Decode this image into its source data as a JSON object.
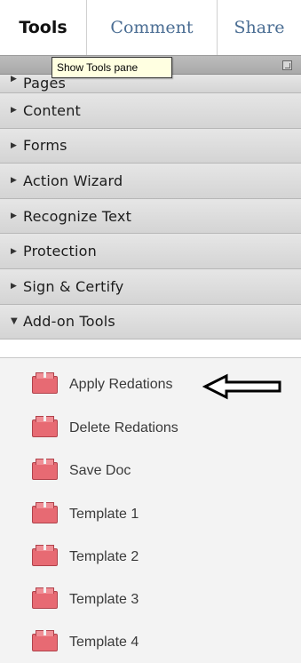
{
  "tabs": {
    "tools": "Tools",
    "comment": "Comment",
    "share": "Share"
  },
  "tooltip": "Show Tools pane",
  "panels": [
    {
      "label": "Pages",
      "state": "collapsed"
    },
    {
      "label": "Content",
      "state": "collapsed"
    },
    {
      "label": "Forms",
      "state": "collapsed"
    },
    {
      "label": "Action Wizard",
      "state": "collapsed"
    },
    {
      "label": "Recognize Text",
      "state": "collapsed"
    },
    {
      "label": "Protection",
      "state": "collapsed"
    },
    {
      "label": "Sign & Certify",
      "state": "collapsed"
    },
    {
      "label": "Add-on Tools",
      "state": "expanded"
    }
  ],
  "addon_tools": [
    {
      "label": "Apply Redations",
      "icon": "toolbox-icon"
    },
    {
      "label": "Delete Redations",
      "icon": "toolbox-icon"
    },
    {
      "label": "Save Doc",
      "icon": "toolbox-icon"
    },
    {
      "label": "Template 1",
      "icon": "toolbox-icon"
    },
    {
      "label": "Template 2",
      "icon": "toolbox-icon"
    },
    {
      "label": "Template 3",
      "icon": "toolbox-icon"
    },
    {
      "label": "Template 4",
      "icon": "toolbox-icon"
    }
  ],
  "colors": {
    "tab_text": "#4a6d93",
    "panel_bg": "#dcdcdc",
    "tool_icon": "#e76a73",
    "tooltip_bg": "#ffffe1"
  }
}
